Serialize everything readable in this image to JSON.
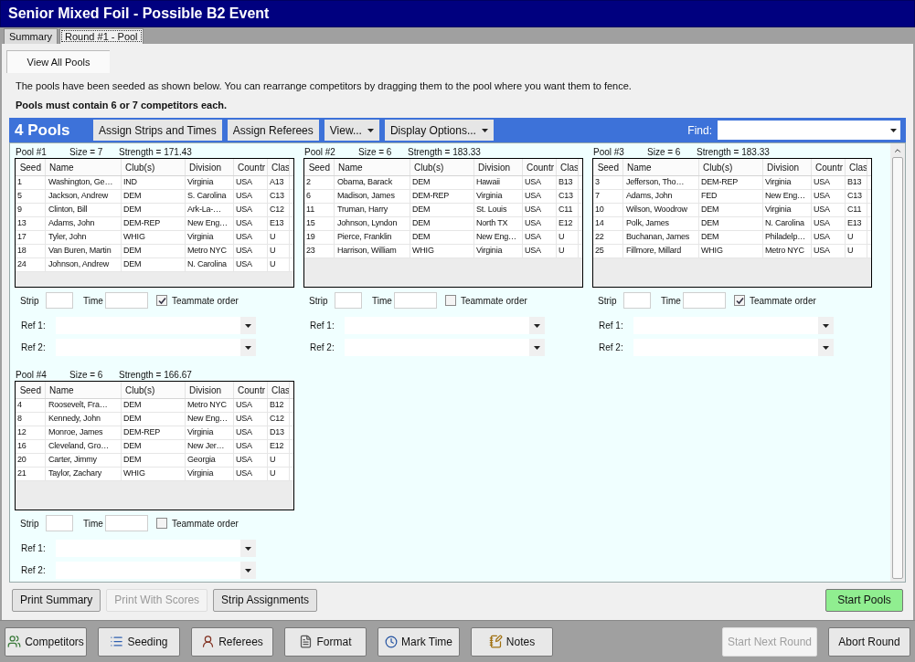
{
  "window": {
    "title": "Senior Mixed Foil - Possible B2 Event"
  },
  "tabs": [
    {
      "label": "Summary",
      "selected": false
    },
    {
      "label": "Round #1 - Pool",
      "selected": true
    }
  ],
  "subtabs": [
    {
      "label": "View All Pools",
      "selected": true
    }
  ],
  "intro": "The pools have been seeded as shown below.  You can rearrange competitors by dragging them to the pool where you want them to fence.",
  "rule": "Pools must contain 6 or 7 competitors each.",
  "toolbar": {
    "title": "4 Pools",
    "buttons": [
      {
        "label": "Assign Strips and Times",
        "kind": "plain"
      },
      {
        "label": "Assign Referees",
        "kind": "plain"
      },
      {
        "label": "View...",
        "kind": "menu"
      },
      {
        "label": "Display Options...",
        "kind": "menu"
      }
    ],
    "find_label": "Find:"
  },
  "pools": [
    {
      "label": "Pool #1",
      "size": "Size = 7",
      "strength": "Strength = 171.43",
      "columns": [
        "Seed",
        "Name",
        "Club(s)",
        "Division",
        "Countr",
        "Clas"
      ],
      "rows": [
        [
          "1",
          "Washington, Ge…",
          "IND",
          "Virginia",
          "USA",
          "A13"
        ],
        [
          "5",
          "Jackson, Andrew",
          "DEM",
          "S. Carolina",
          "USA",
          "C13"
        ],
        [
          "9",
          "Clinton, Bill",
          "DEM",
          "Ark-La-…",
          "USA",
          "C12"
        ],
        [
          "13",
          "Adams, John",
          "DEM-REP",
          "New Eng…",
          "USA",
          "E13"
        ],
        [
          "17",
          "Tyler, John",
          "WHIG",
          "Virginia",
          "USA",
          "U"
        ],
        [
          "18",
          "Van Buren, Martin",
          "DEM",
          "Metro NYC",
          "USA",
          "U"
        ],
        [
          "24",
          "Johnson, Andrew",
          "DEM",
          "N. Carolina",
          "USA",
          "U"
        ]
      ],
      "strip_label": "Strip",
      "time_label": "Time",
      "teammate_label": "Teammate order",
      "teammate_order": true,
      "ref1_label": "Ref 1:",
      "ref2_label": "Ref 2:"
    },
    {
      "label": "Pool #2",
      "size": "Size = 6",
      "strength": "Strength = 183.33",
      "columns": [
        "Seed",
        "Name",
        "Club(s)",
        "Division",
        "Countr",
        "Clas"
      ],
      "rows": [
        [
          "2",
          "Obama, Barack",
          "DEM",
          "Hawaii",
          "USA",
          "B13"
        ],
        [
          "6",
          "Madison, James",
          "DEM-REP",
          "Virginia",
          "USA",
          "C13"
        ],
        [
          "11",
          "Truman, Harry",
          "DEM",
          "St. Louis",
          "USA",
          "C11"
        ],
        [
          "15",
          "Johnson, Lyndon",
          "DEM",
          "North TX",
          "USA",
          "E12"
        ],
        [
          "19",
          "Pierce, Franklin",
          "DEM",
          "New Eng…",
          "USA",
          "U"
        ],
        [
          "23",
          "Harrison, William",
          "WHIG",
          "Virginia",
          "USA",
          "U"
        ]
      ],
      "strip_label": "Strip",
      "time_label": "Time",
      "teammate_label": "Teammate order",
      "teammate_order": false,
      "ref1_label": "Ref 1:",
      "ref2_label": "Ref 2:"
    },
    {
      "label": "Pool #3",
      "size": "Size = 6",
      "strength": "Strength = 183.33",
      "columns": [
        "Seed",
        "Name",
        "Club(s)",
        "Division",
        "Countr",
        "Clas"
      ],
      "rows": [
        [
          "3",
          "Jefferson, Tho…",
          "DEM-REP",
          "Virginia",
          "USA",
          "B13"
        ],
        [
          "7",
          "Adams, John",
          "FED",
          "New Eng…",
          "USA",
          "C13"
        ],
        [
          "10",
          "Wilson, Woodrow",
          "DEM",
          "Virginia",
          "USA",
          "C11"
        ],
        [
          "14",
          "Polk, James",
          "DEM",
          "N. Carolina",
          "USA",
          "E13"
        ],
        [
          "22",
          "Buchanan, James",
          "DEM",
          "Philadelp…",
          "USA",
          "U"
        ],
        [
          "25",
          "Fillmore, Millard",
          "WHIG",
          "Metro NYC",
          "USA",
          "U"
        ]
      ],
      "strip_label": "Strip",
      "time_label": "Time",
      "teammate_label": "Teammate order",
      "teammate_order": true,
      "ref1_label": "Ref 1:",
      "ref2_label": "Ref 2:"
    },
    {
      "label": "Pool #4",
      "size": "Size = 6",
      "strength": "Strength = 166.67",
      "columns": [
        "Seed",
        "Name",
        "Club(s)",
        "Division",
        "Countr",
        "Clas"
      ],
      "rows": [
        [
          "4",
          "Roosevelt, Fra…",
          "DEM",
          "Metro NYC",
          "USA",
          "B12"
        ],
        [
          "8",
          "Kennedy, John",
          "DEM",
          "New Eng…",
          "USA",
          "C12"
        ],
        [
          "12",
          "Monroe, James",
          "DEM-REP",
          "Virginia",
          "USA",
          "D13"
        ],
        [
          "16",
          "Cleveland, Gro…",
          "DEM",
          "New Jer…",
          "USA",
          "E12"
        ],
        [
          "20",
          "Carter, Jimmy",
          "DEM",
          "Georgia",
          "USA",
          "U"
        ],
        [
          "21",
          "Taylor, Zachary",
          "WHIG",
          "Virginia",
          "USA",
          "U"
        ]
      ],
      "strip_label": "Strip",
      "time_label": "Time",
      "teammate_label": "Teammate order",
      "teammate_order": false,
      "ref1_label": "Ref 1:",
      "ref2_label": "Ref 2:"
    }
  ],
  "actions": [
    {
      "label": "Print Summary",
      "disabled": false,
      "kind": "plain"
    },
    {
      "label": "Print With Scores",
      "disabled": true,
      "kind": "plain"
    },
    {
      "label": "Strip Assignments",
      "disabled": false,
      "kind": "plain"
    },
    {
      "label": "Start Pools",
      "disabled": false,
      "kind": "go"
    }
  ],
  "nav": [
    {
      "label": "Competitors",
      "kind": "competitors",
      "disabled": false
    },
    {
      "label": "Seeding",
      "kind": "seeding",
      "disabled": false
    },
    {
      "label": "Referees",
      "kind": "referees",
      "disabled": false
    },
    {
      "label": "Format",
      "kind": "format",
      "disabled": false
    },
    {
      "label": "Mark Time",
      "kind": "time",
      "disabled": false
    },
    {
      "label": "Notes",
      "kind": "notes",
      "disabled": false
    },
    {
      "label": "Start Next Round",
      "kind": "none",
      "disabled": true
    },
    {
      "label": "Abort Round",
      "kind": "none",
      "disabled": false
    }
  ]
}
